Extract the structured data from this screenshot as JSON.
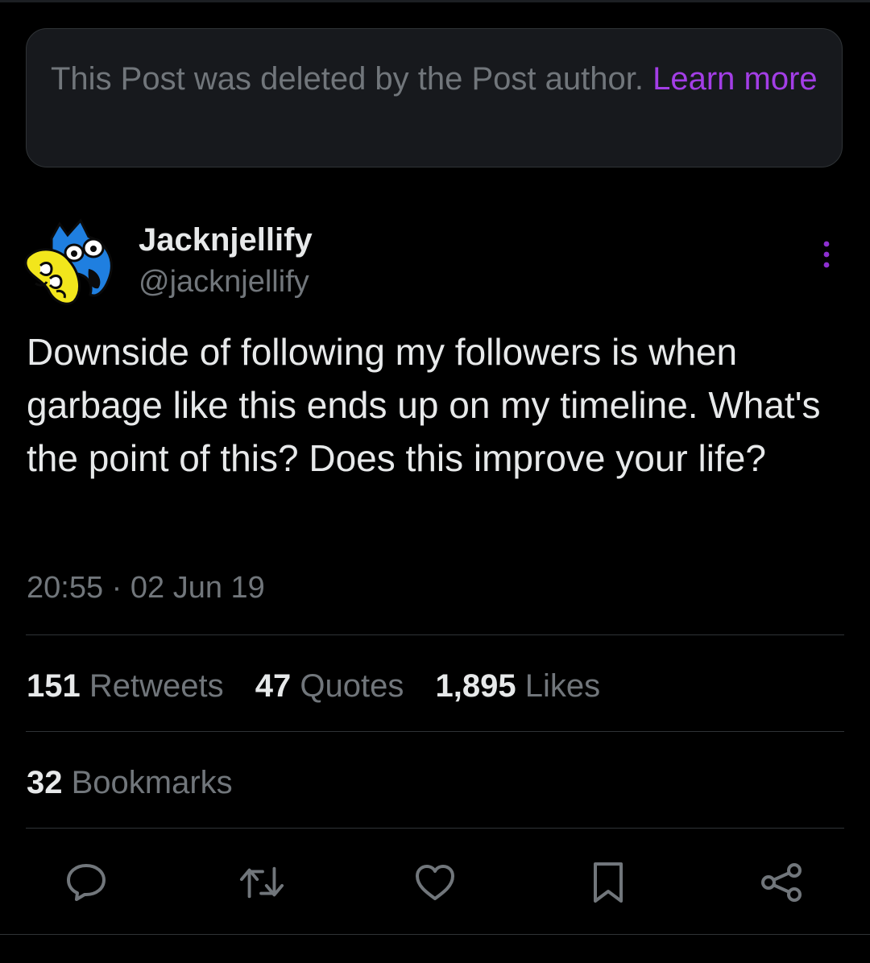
{
  "notice": {
    "text": "This Post was deleted by the Post author.",
    "link_label": "Learn more"
  },
  "author": {
    "display_name": "Jacknjellify",
    "handle": "@jacknjellify",
    "avatar_icon": "jack-and-jelly-avatar-icon"
  },
  "tweet": {
    "text": "Downside of following my followers is when garbage like this ends up on my timeline. What's the point of this? Does this improve your life?",
    "time": "20:55",
    "separator": "·",
    "date": "02 Jun 19"
  },
  "stats": {
    "retweets": {
      "count": "151",
      "label": "Retweets"
    },
    "quotes": {
      "count": "47",
      "label": "Quotes"
    },
    "likes": {
      "count": "1,895",
      "label": "Likes"
    },
    "bookmarks": {
      "count": "32",
      "label": "Bookmarks"
    }
  },
  "actions": {
    "reply_icon": "reply-icon",
    "retweet_icon": "retweet-icon",
    "like_icon": "heart-icon",
    "bookmark_icon": "bookmark-icon",
    "share_icon": "share-icon",
    "more_icon": "more-vertical-icon"
  },
  "colors": {
    "background": "#000000",
    "text_primary": "#e7e9ea",
    "text_secondary": "#71767b",
    "link": "#a33ee6",
    "accent_purple": "#8d2fd0",
    "notice_bg": "#17191d",
    "divider": "#2f3336"
  }
}
